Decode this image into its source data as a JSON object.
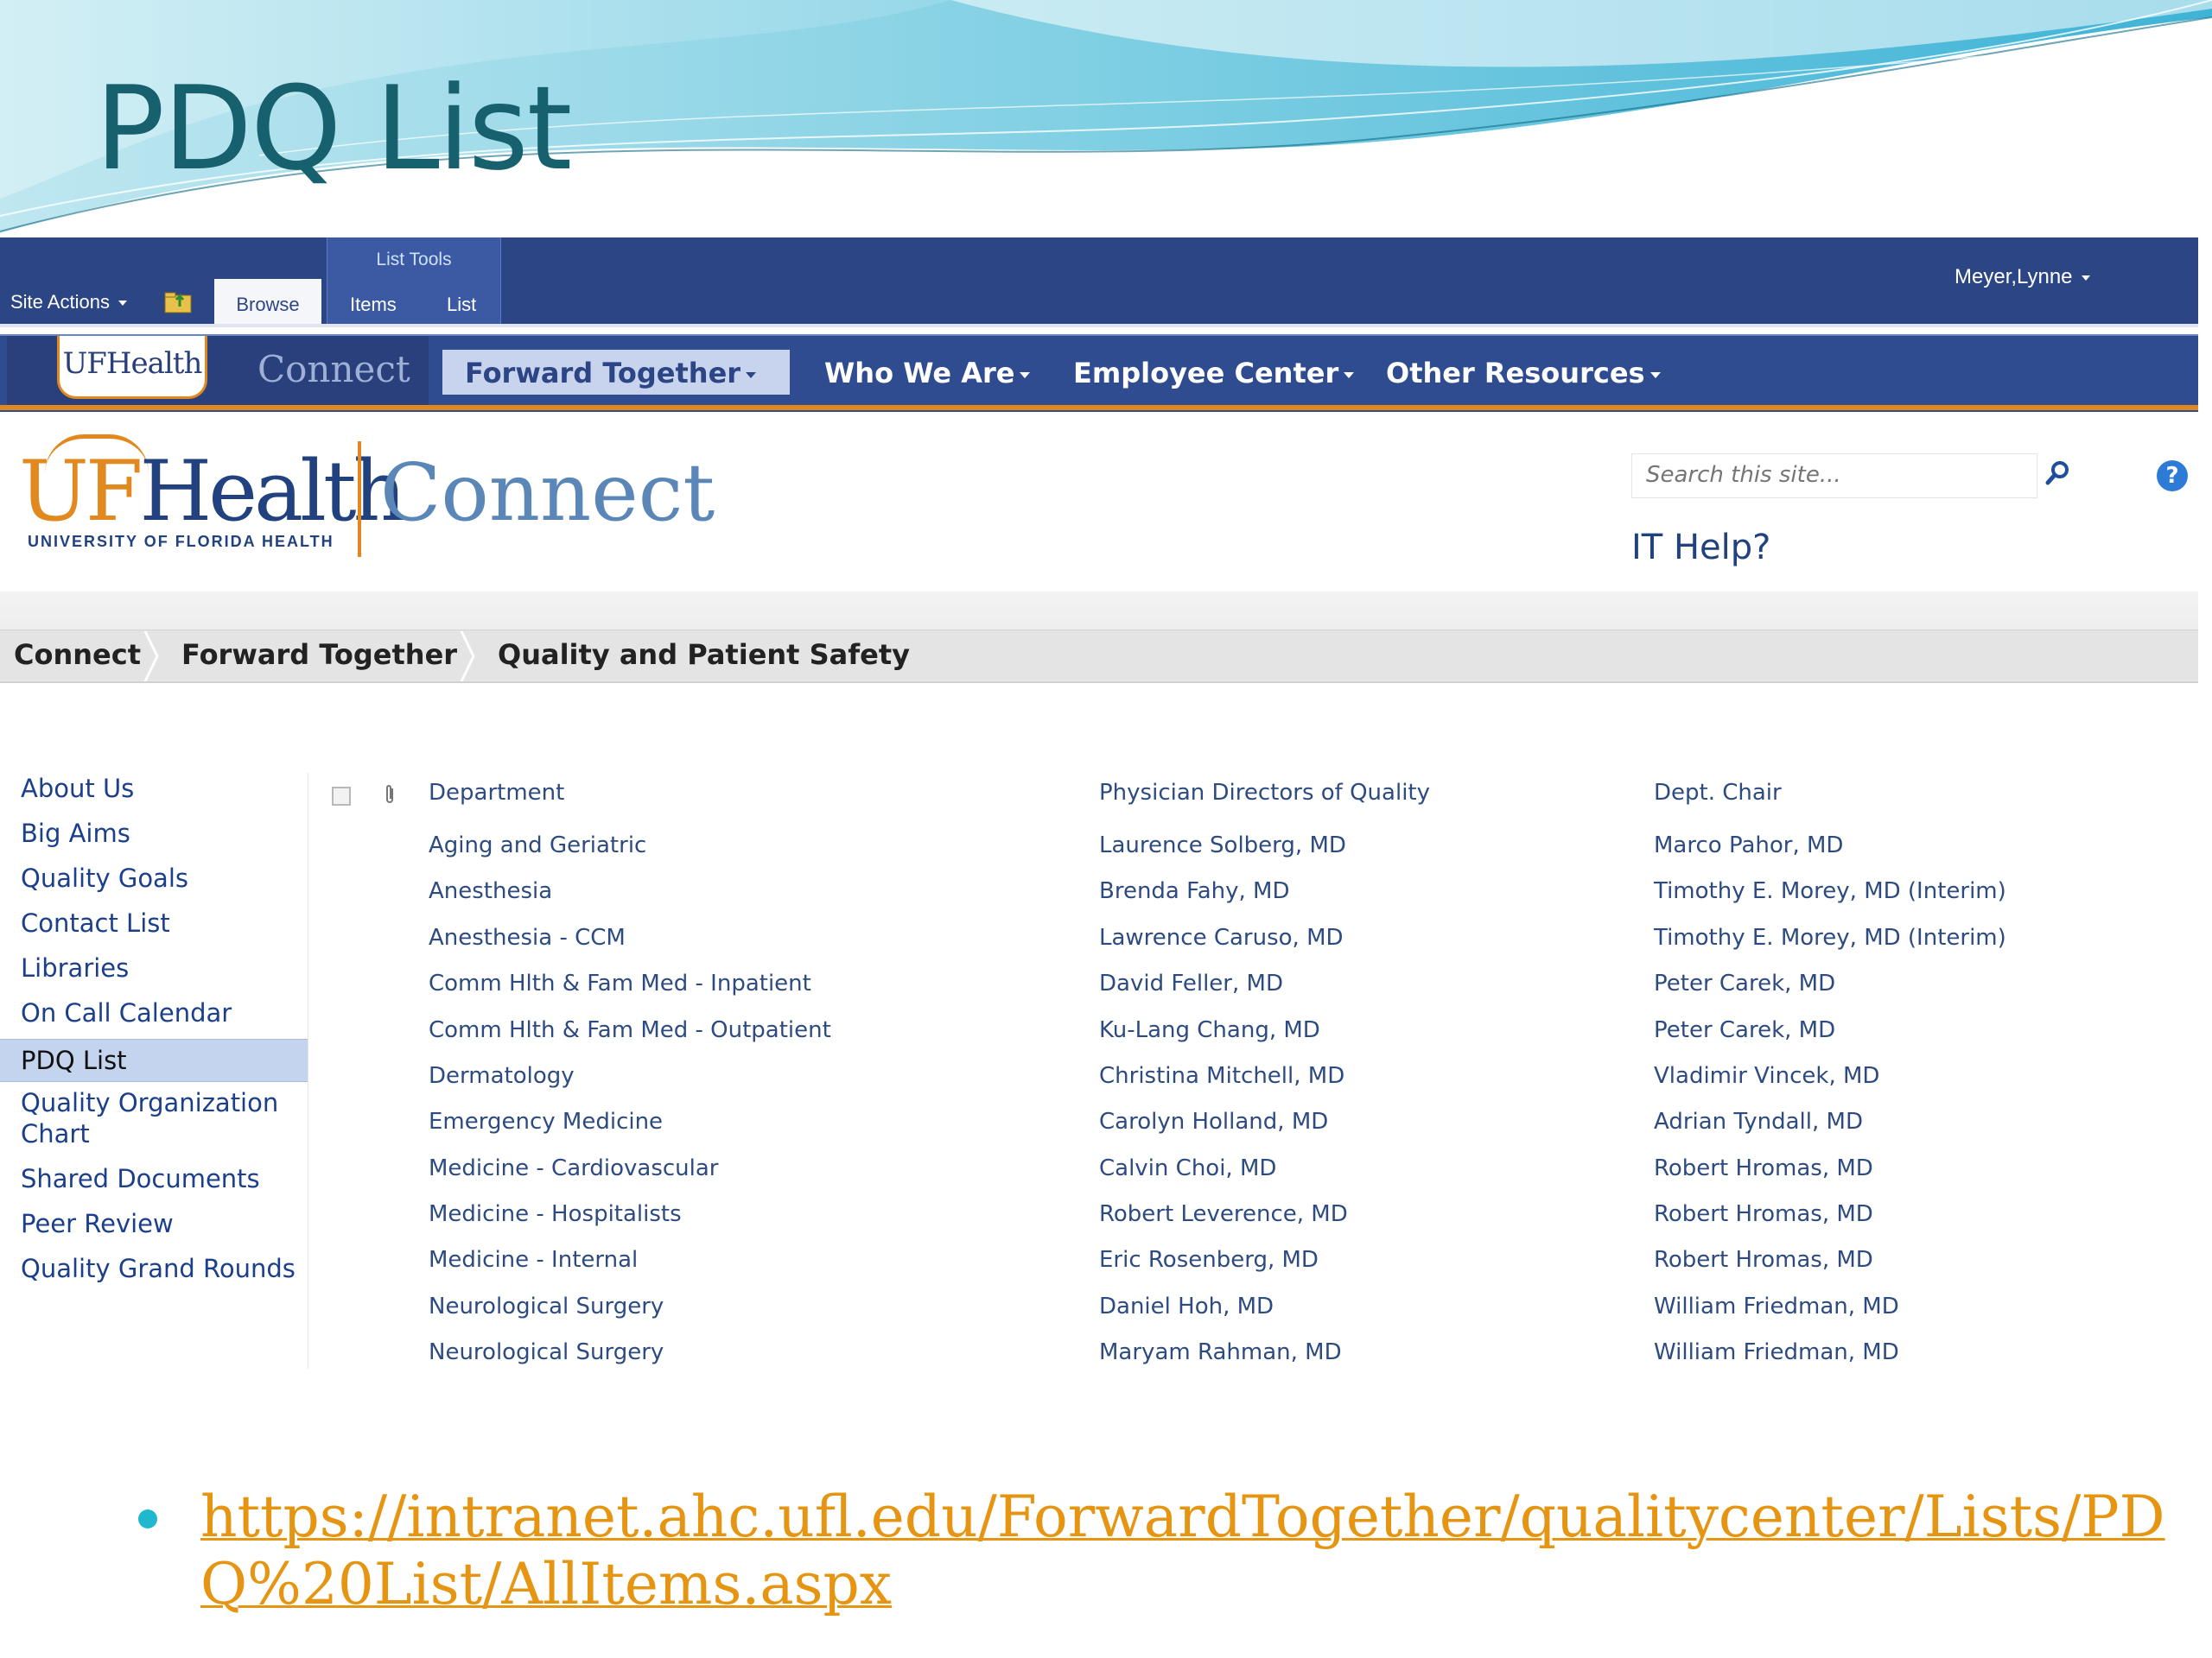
{
  "slide": {
    "title": "PDQ List",
    "url_line1": "https://intranet.ahc.ufl.edu/ForwardTogether/qualitycenter/Lists/PD",
    "url_line2": "Q%20List/AllItems.aspx"
  },
  "ribbon": {
    "site_actions": "Site Actions",
    "list_tools": "List Tools",
    "tabs": [
      "Browse",
      "Items",
      "List"
    ],
    "user": "Meyer,Lynne"
  },
  "topnav": {
    "logo_text": "UFHealth",
    "logo_connect": "Connect",
    "items": [
      "Forward Together",
      "Who We Are",
      "Employee Center",
      "Other Resources"
    ]
  },
  "header": {
    "brand_name": "UFHealth",
    "brand_sub": "UNIVERSITY OF FLORIDA HEALTH",
    "brand_connect": "Connect",
    "search_placeholder": "Search this site...",
    "it_help": "IT Help?"
  },
  "breadcrumb": [
    "Connect",
    "Forward Together",
    "Quality and Patient Safety"
  ],
  "leftnav": [
    "About Us",
    "Big Aims",
    "Quality Goals",
    "Contact List",
    "Libraries",
    "On Call Calendar",
    "PDQ List",
    "Quality Organization Chart",
    "Shared Documents",
    "Peer Review",
    "Quality Grand Rounds"
  ],
  "leftnav_active": "PDQ List",
  "list": {
    "headers": [
      "Department",
      "Physician Directors of Quality",
      "Dept. Chair"
    ],
    "rows": [
      [
        "Aging and Geriatric",
        "Laurence Solberg, MD",
        "Marco Pahor, MD"
      ],
      [
        "Anesthesia",
        "Brenda Fahy, MD",
        "Timothy E. Morey, MD (Interim)"
      ],
      [
        "Anesthesia - CCM",
        "Lawrence Caruso, MD",
        "Timothy E. Morey, MD (Interim)"
      ],
      [
        "Comm Hlth & Fam Med - Inpatient",
        "David Feller, MD",
        "Peter Carek, MD"
      ],
      [
        "Comm Hlth & Fam Med - Outpatient",
        "Ku-Lang Chang, MD",
        "Peter Carek, MD"
      ],
      [
        "Dermatology",
        "Christina Mitchell, MD",
        "Vladimir Vincek, MD"
      ],
      [
        "Emergency Medicine",
        "Carolyn Holland, MD",
        "Adrian Tyndall, MD"
      ],
      [
        "Medicine - Cardiovascular",
        "Calvin Choi, MD",
        "Robert Hromas, MD"
      ],
      [
        "Medicine - Hospitalists",
        "Robert Leverence, MD",
        "Robert Hromas, MD"
      ],
      [
        "Medicine - Internal",
        "Eric Rosenberg, MD",
        "Robert Hromas, MD"
      ],
      [
        "Neurological Surgery",
        "Daniel Hoh, MD",
        "William Friedman, MD"
      ],
      [
        "Neurological Surgery",
        "Maryam Rahman, MD",
        "William Friedman, MD"
      ]
    ]
  },
  "colors": {
    "title": "#17606e",
    "ribbon": "#2c4585",
    "nav": "#2f4c91",
    "accent_orange": "#e1891f",
    "link": "#2d4b80",
    "url": "#e59512",
    "bullet": "#20b8cf"
  }
}
